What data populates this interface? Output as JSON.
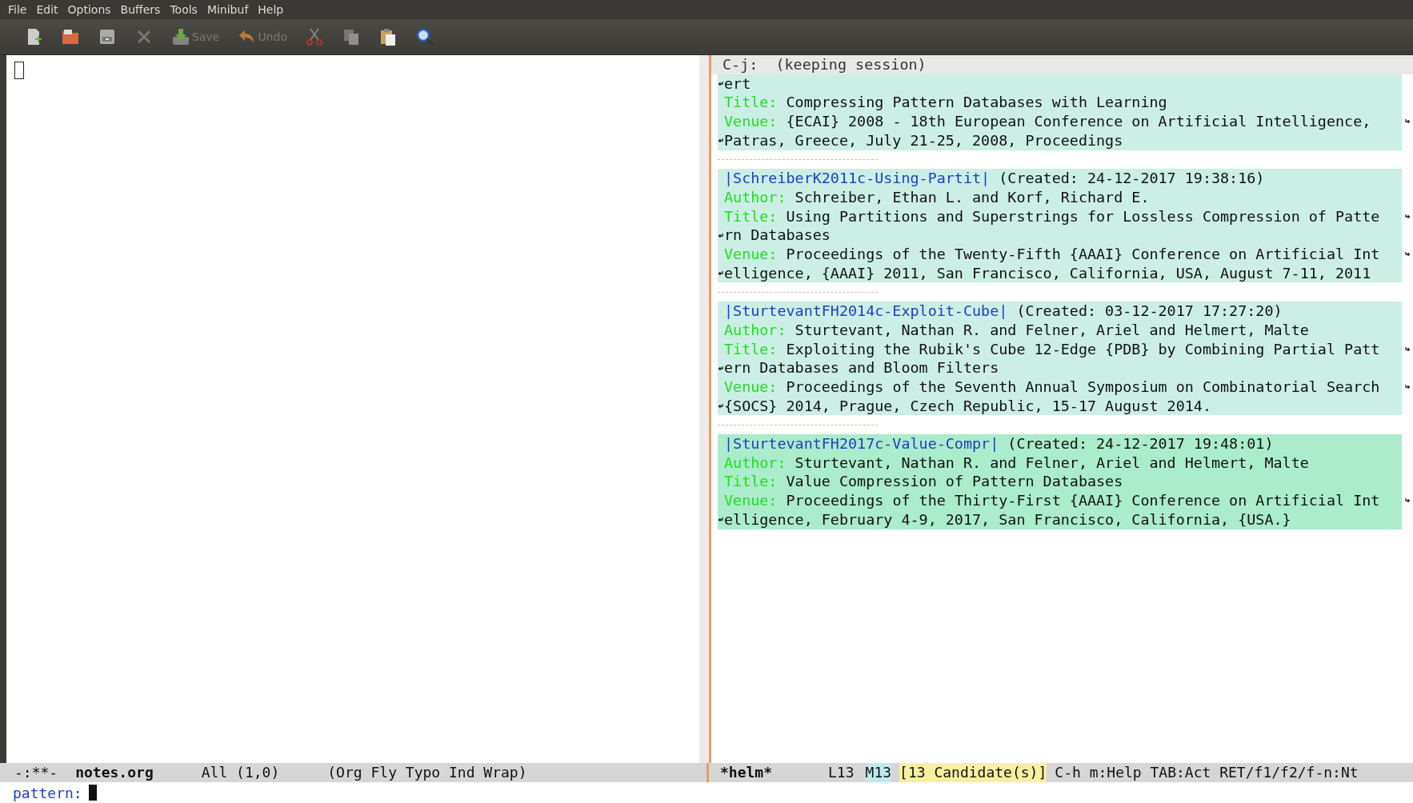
{
  "menu_bar": [
    "File",
    "Edit",
    "Options",
    "Buffers",
    "Tools",
    "Minibuf",
    "Help"
  ],
  "toolbar": [
    {
      "kind": "new",
      "disabled": false
    },
    {
      "kind": "open",
      "disabled": false
    },
    {
      "kind": "dired",
      "disabled": false
    },
    {
      "kind": "close",
      "disabled": true
    },
    {
      "kind": "save",
      "label": "Save",
      "disabled": true
    },
    {
      "kind": "undo",
      "label": "Undo",
      "disabled": true
    },
    {
      "kind": "cut",
      "disabled": true
    },
    {
      "kind": "copy",
      "disabled": true
    },
    {
      "kind": "paste",
      "disabled": false
    },
    {
      "kind": "search",
      "disabled": false
    }
  ],
  "helm": {
    "header": "C-j:  (keeping session)",
    "candidates": [
      {
        "selected": false,
        "lines": [
          {
            "text": "ert",
            "wrapped_from": true
          },
          {
            "label": "Title:",
            "text": "Compressing Pattern Databases with Learning"
          },
          {
            "label": "Venue:",
            "text": "{ECAI} 2008 - 18th European Conference on Artificial Intelligence, ",
            "wraps": true
          },
          {
            "text": "Patras, Greece, July 21-25, 2008, Proceedings",
            "wrapped_from": true
          }
        ]
      },
      {
        "selected": false,
        "lines": [
          {
            "key": "|SchreiberK2011c-Using-Partit|",
            "text": " (Created: 24-12-2017 19:38:16)"
          },
          {
            "label": "Author:",
            "text": "Schreiber, Ethan L. and Korf, Richard E."
          },
          {
            "label": "Title:",
            "text": "Using Partitions and Superstrings for Lossless Compression of Patte",
            "wraps": true
          },
          {
            "text": "rn Databases",
            "wrapped_from": true
          },
          {
            "label": "Venue:",
            "text": "Proceedings of the Twenty-Fifth {AAAI} Conference on Artificial Int",
            "wraps": true
          },
          {
            "text": "elligence, {AAAI} 2011, San Francisco, California, USA, August 7-11, 2011",
            "wrapped_from": true
          }
        ]
      },
      {
        "selected": false,
        "lines": [
          {
            "key": "|SturtevantFH2014c-Exploit-Cube|",
            "text": " (Created: 03-12-2017 17:27:20)"
          },
          {
            "label": "Author:",
            "text": "Sturtevant, Nathan R. and Felner, Ariel and Helmert, Malte"
          },
          {
            "label": "Title:",
            "text": "Exploiting the Rubik's Cube 12-Edge {PDB} by Combining Partial Patt",
            "wraps": true
          },
          {
            "text": "ern Databases and Bloom Filters",
            "wrapped_from": true
          },
          {
            "label": "Venue:",
            "text": "Proceedings of the Seventh Annual Symposium on Combinatorial Search",
            "wraps": true
          },
          {
            "text": "{SOCS} 2014, Prague, Czech Republic, 15-17 August 2014.",
            "wrapped_from": true
          }
        ]
      },
      {
        "selected": true,
        "lines": [
          {
            "key": "|SturtevantFH2017c-Value-Compr|",
            "text": " (Created: 24-12-2017 19:48:01)"
          },
          {
            "label": "Author:",
            "text": "Sturtevant, Nathan R. and Felner, Ariel and Helmert, Malte"
          },
          {
            "label": "Title:",
            "text": "Value Compression of Pattern Databases"
          },
          {
            "label": "Venue:",
            "text": "Proceedings of the Thirty-First {AAAI} Conference on Artificial Int",
            "wraps": true
          },
          {
            "text": "elligence, February 4-9, 2017, San Francisco, California, {USA.}",
            "wrapped_from": true
          }
        ]
      }
    ]
  },
  "mode_line_left": {
    "status": "-:**-",
    "buffer": "notes.org",
    "position": "All (1,0)",
    "modes": "(Org Fly Typo Ind Wrap)"
  },
  "mode_line_right": {
    "buffer": "*helm*",
    "line": "L13",
    "mark": "M13",
    "candidates": "[13 Candidate(s)]",
    "help": "C-h m:Help TAB:Act RET/f1/f2/f-n:Nt"
  },
  "minibuffer": {
    "prompt": "pattern:"
  }
}
